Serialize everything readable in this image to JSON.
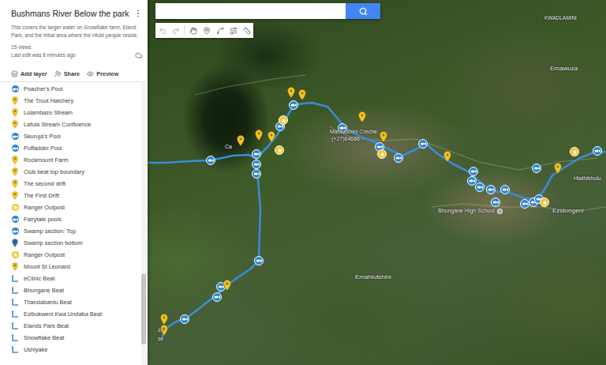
{
  "map": {
    "title": "Bushmans River Below the park",
    "description": "This covers the larger water on Snowflake farm, Eland Park, and the tribal area where the Hlubi people reside.",
    "views": "15 views",
    "last_edit": "Last edit was 8 minutes ago"
  },
  "actions": [
    {
      "label": "Add layer"
    },
    {
      "label": "Share"
    },
    {
      "label": "Preview"
    }
  ],
  "layer_items": [
    {
      "label": "Poacher's Pool",
      "kind": "fish",
      "color": "#2a86d6"
    },
    {
      "label": "The Trout Hatchery",
      "kind": "pin",
      "color": "#f6c324"
    },
    {
      "label": "Lolambazo Stream",
      "kind": "pin",
      "color": "#f6c324"
    },
    {
      "label": "Lafula Stream Confluence",
      "kind": "pin",
      "color": "#f6c324"
    },
    {
      "label": "Skuruja's Pool",
      "kind": "fish",
      "color": "#2a86d6"
    },
    {
      "label": "Puffadder Pool",
      "kind": "fish",
      "color": "#2a86d6"
    },
    {
      "label": "Rockmount Farm",
      "kind": "pin",
      "color": "#f6c324"
    },
    {
      "label": "Club beat top boundary",
      "kind": "pin",
      "color": "#f6c324"
    },
    {
      "label": "The second drift",
      "kind": "pin",
      "color": "#f6c324"
    },
    {
      "label": "The First Drift",
      "kind": "pin",
      "color": "#f6c324"
    },
    {
      "label": "Ranger Outpost",
      "kind": "outpost",
      "color": "#f6c324"
    },
    {
      "label": "Fairytale pools",
      "kind": "fish",
      "color": "#2a86d6"
    },
    {
      "label": "Swamp section: Top",
      "kind": "fish",
      "color": "#2a86d6"
    },
    {
      "label": "Swamp section bottom",
      "kind": "pin",
      "color": "#1c6cb8"
    },
    {
      "label": "Ranger Outpost",
      "kind": "outpost",
      "color": "#f6c324"
    },
    {
      "label": "Mount St Leonard",
      "kind": "pin",
      "color": "#f6c324"
    },
    {
      "label": "eClinic Beat",
      "kind": "line",
      "color": "#4a90d9"
    },
    {
      "label": "Bhungane Beat",
      "kind": "line",
      "color": "#4a90d9"
    },
    {
      "label": "Thandabantu Beat",
      "kind": "line",
      "color": "#4a90d9"
    },
    {
      "label": "Ezibukweni Kwa Undaba Beat",
      "kind": "line",
      "color": "#4a90d9"
    },
    {
      "label": "Elands Park Beat",
      "kind": "line",
      "color": "#4a90d9"
    },
    {
      "label": "Snowflake Beat",
      "kind": "line",
      "color": "#4a90d9"
    },
    {
      "label": "Ushiyake",
      "kind": "line",
      "color": "#4a90d9"
    }
  ],
  "map_labels": [
    {
      "text": "KWADLAMINI",
      "kind": "place"
    },
    {
      "text": "Emawuza",
      "kind": "place"
    },
    {
      "text": "Hlathikhulu",
      "kind": "place"
    },
    {
      "text": "Ezidongeni",
      "kind": "place"
    },
    {
      "text": "Bhungane High School",
      "kind": "poi"
    },
    {
      "text": "Emahlutshini",
      "kind": "place"
    },
    {
      "text": "Mahlutshini Creche",
      "kind": "place"
    },
    {
      "text": "(+27)64686",
      "kind": "place"
    },
    {
      "text": "Ca",
      "kind": "place"
    },
    {
      "text": "zo",
      "kind": "place"
    },
    {
      "text": "se",
      "kind": "place"
    }
  ]
}
